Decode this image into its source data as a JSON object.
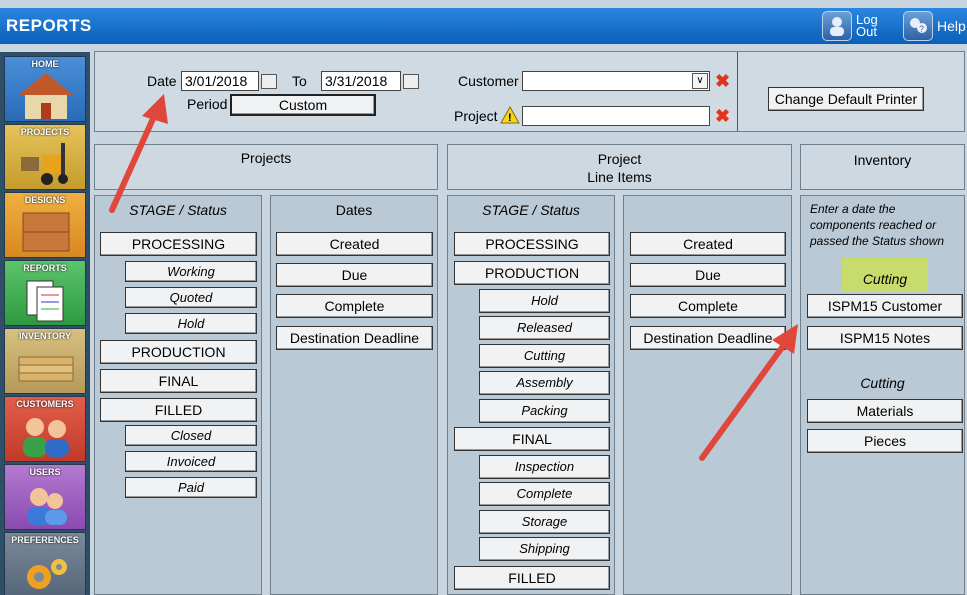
{
  "app": {
    "title": "REPORTS",
    "logout_label_1": "Log",
    "logout_label_2": "Out",
    "help_label": "Help"
  },
  "nav": [
    "HOME",
    "PROJECTS",
    "DESIGNS",
    "REPORTS",
    "INVENTORY",
    "CUSTOMERS",
    "USERS",
    "PREFERENCES"
  ],
  "filters": {
    "date_label": "Date",
    "date_from": "3/01/2018",
    "to_label": "To",
    "date_to": "3/31/2018",
    "period_label": "Period",
    "period_value": "Custom",
    "customer_label": "Customer",
    "customer_value": "",
    "project_label": "Project",
    "project_value": "",
    "printer_button": "Change Default Printer"
  },
  "headers": {
    "projects": "Projects",
    "project_line_1": "Project",
    "project_line_2": "Line Items",
    "inventory": "Inventory"
  },
  "projects_stage": {
    "title": "STAGE / Status",
    "items": [
      "PROCESSING",
      "Working",
      "Quoted",
      "Hold",
      "PRODUCTION",
      "FINAL",
      "FILLED",
      "Closed",
      "Invoiced",
      "Paid"
    ]
  },
  "projects_dates": {
    "title": "Dates",
    "items": [
      "Created",
      "Due",
      "Complete",
      "Destination Deadline"
    ]
  },
  "lines_stage": {
    "title": "STAGE / Status",
    "items": [
      "PROCESSING",
      "PRODUCTION",
      "Hold",
      "Released",
      "Cutting",
      "Assembly",
      "Packing",
      "FINAL",
      "Inspection",
      "Complete",
      "Storage",
      "Shipping",
      "FILLED"
    ]
  },
  "lines_dates": {
    "items": [
      "Created",
      "Due",
      "Complete",
      "Destination Deadline"
    ]
  },
  "inventory": {
    "note": "Enter a date the components reached or passed the Status shown",
    "status_highlight": "Cutting",
    "btn_ispm_customer": "ISPM15 Customer",
    "btn_ispm_notes": "ISPM15 Notes",
    "status_label": "Cutting",
    "btn_materials": "Materials",
    "btn_pieces": "Pieces"
  },
  "colors": {
    "titlebar": "#0b5fb8",
    "arrow": "#e0473c",
    "highlight": "#c7dc6a"
  }
}
